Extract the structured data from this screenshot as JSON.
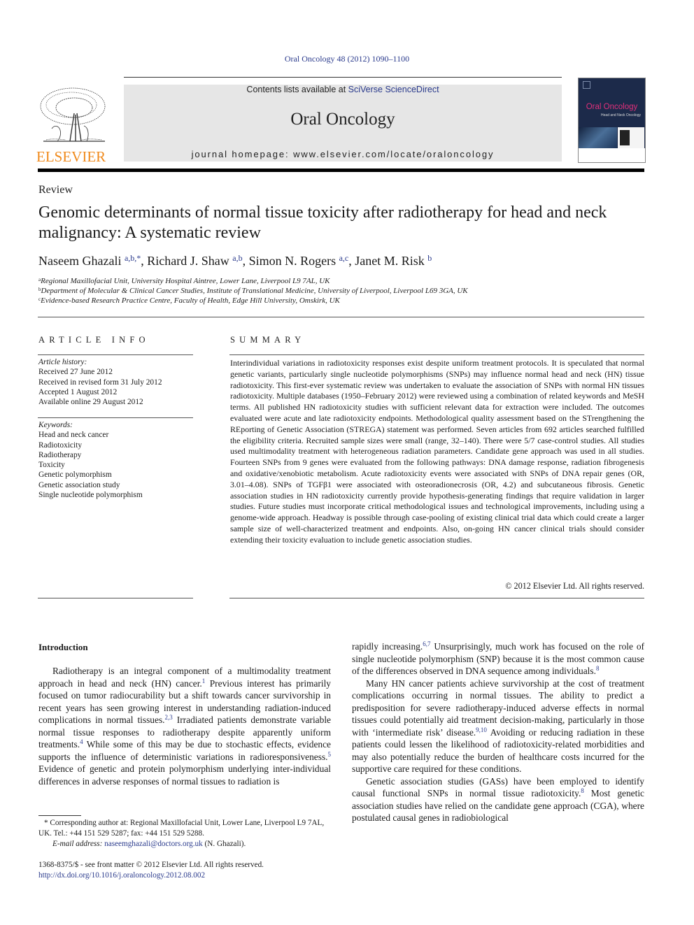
{
  "header": {
    "citation": "Oral Oncology 48 (2012) 1090–1100",
    "contents_prefix": "Contents lists available at ",
    "contents_link": "SciVerse ScienceDirect",
    "journal_title": "Oral Oncology",
    "homepage_label": "journal homepage: ",
    "homepage_url": "www.elsevier.com/locate/oraloncology",
    "publisher_logo_text": "ELSEVIER",
    "cover": {
      "title": "Oral Oncology",
      "subtitle": "Head and Neck Oncology"
    },
    "colors": {
      "link": "#2a3a8c",
      "elsevier_orange": "#f08a1c",
      "banner_bg": "#e6e6e6",
      "cover_bg": "#1c2a4a",
      "cover_title": "#e0307a"
    }
  },
  "article": {
    "section_type": "Review",
    "title": "Genomic determinants of normal tissue toxicity after radiotherapy for head and neck malignancy: A systematic review",
    "authors": [
      {
        "name": "Naseem Ghazali",
        "affil": "a,b,*"
      },
      {
        "name": "Richard J. Shaw",
        "affil": "a,b"
      },
      {
        "name": "Simon N. Rogers",
        "affil": "a,c"
      },
      {
        "name": "Janet M. Risk",
        "affil": "b"
      }
    ],
    "affiliations": [
      {
        "key": "a",
        "text": "Regional Maxillofacial Unit, University Hospital Aintree, Lower Lane, Liverpool L9 7AL, UK"
      },
      {
        "key": "b",
        "text": "Department of Molecular & Clinical Cancer Studies, Institute of Translational Medicine, University of Liverpool, Liverpool L69 3GA, UK"
      },
      {
        "key": "c",
        "text": "Evidence-based Research Practice Centre, Faculty of Health, Edge Hill University, Omskirk, UK"
      }
    ]
  },
  "article_info": {
    "heading": "ARTICLE INFO",
    "history_label": "Article history:",
    "history": [
      "Received 27 June 2012",
      "Received in revised form 31 July 2012",
      "Accepted 1 August 2012",
      "Available online 29 August 2012"
    ],
    "keywords_label": "Keywords:",
    "keywords": [
      "Head and neck cancer",
      "Radiotoxicity",
      "Radiotherapy",
      "Toxicity",
      "Genetic polymorphism",
      "Genetic association study",
      "Single nucleotide polymorphism"
    ]
  },
  "summary": {
    "heading": "SUMMARY",
    "text": "Interindividual variations in radiotoxicity responses exist despite uniform treatment protocols. It is speculated that normal genetic variants, particularly single nucleotide polymorphisms (SNPs) may influence normal head and neck (HN) tissue radiotoxicity. This first-ever systematic review was undertaken to evaluate the association of SNPs with normal HN tissues radiotoxicity. Multiple databases (1950–February 2012) were reviewed using a combination of related keywords and MeSH terms. All published HN radiotoxicity studies with sufficient relevant data for extraction were included. The outcomes evaluated were acute and late radiotoxicity endpoints. Methodological quality assessment based on the STrengthening the REporting of Genetic Association (STREGA) statement was performed. Seven articles from 692 articles searched fulfilled the eligibility criteria. Recruited sample sizes were small (range, 32–140). There were 5/7 case-control studies. All studies used multimodality treatment with heterogeneous radiation parameters. Candidate gene approach was used in all studies. Fourteen SNPs from 9 genes were evaluated from the following pathways: DNA damage response, radiation fibrogenesis and oxidative/xenobiotic metabolism. Acute radiotoxicity events were associated with SNPs of DNA repair genes (OR, 3.01–4.08). SNPs of TGFβ1 were associated with osteoradionecrosis (OR, 4.2) and subcutaneous fibrosis. Genetic association studies in HN radiotoxicity currently provide hypothesis-generating findings that require validation in larger studies. Future studies must incorporate critical methodological issues and technological improvements, including using a genome-wide approach. Headway is possible through case-pooling of existing clinical trial data which could create a larger sample size of well-characterized treatment and endpoints. Also, on-going HN cancer clinical trials should consider extending their toxicity evaluation to include genetic association studies.",
    "copyright": "© 2012 Elsevier Ltd. All rights reserved."
  },
  "body": {
    "intro_heading": "Introduction",
    "left_column": [
      {
        "segments": [
          {
            "t": "Radiotherapy is an integral component of a multimodality treatment approach in head and neck (HN) cancer."
          },
          {
            "ref": "1"
          },
          {
            "t": " Previous interest has primarily focused on tumor radiocurability but a shift towards cancer survivorship in recent years has seen growing interest in understanding radiation-induced complications in normal tissues."
          },
          {
            "ref": "2,3"
          },
          {
            "t": " Irradiated patients demonstrate variable normal tissue responses to radiotherapy despite apparently uniform treatments."
          },
          {
            "ref": "4"
          },
          {
            "t": " While some of this may be due to stochastic effects, evidence supports the influence of deterministic variations in radioresponsiveness."
          },
          {
            "ref": "5"
          },
          {
            "t": " Evidence of genetic and protein polymorphism underlying inter-individual differences in adverse responses of normal tissues to radiation is"
          }
        ]
      }
    ],
    "right_column": [
      {
        "noindent": true,
        "segments": [
          {
            "t": "rapidly increasing."
          },
          {
            "ref": "6,7"
          },
          {
            "t": " Unsurprisingly, much work has focused on the role of single nucleotide polymorphism (SNP) because it is the most common cause of the differences observed in DNA sequence among individuals."
          },
          {
            "ref": "8"
          }
        ]
      },
      {
        "segments": [
          {
            "t": "Many HN cancer patients achieve survivorship at the cost of treatment complications occurring in normal tissues. The ability to predict a predisposition for severe radiotherapy-induced adverse effects in normal tissues could potentially aid treatment decision-making, particularly in those with ‘intermediate risk’ disease."
          },
          {
            "ref": "9,10"
          },
          {
            "t": " Avoiding or reducing radiation in these patients could lessen the likelihood of radiotoxicity-related morbidities and may also potentially reduce the burden of healthcare costs incurred for the supportive care required for these conditions."
          }
        ]
      },
      {
        "segments": [
          {
            "t": "Genetic association studies (GASs) have been employed to identify causal functional SNPs in normal tissue radiotoxicity."
          },
          {
            "ref": "8"
          },
          {
            "t": " Most genetic association studies have relied on the candidate gene approach (CGA), where postulated causal genes in radiobiological"
          }
        ]
      }
    ]
  },
  "footnote": {
    "corresponding": "* Corresponding author at: Regional Maxillofacial Unit, Lower Lane, Liverpool L9 7AL, UK. Tel.: +44 151 529 5287; fax: +44 151 529 5288.",
    "email_label": "E-mail address:",
    "email": "naseemghazali@doctors.org.uk",
    "email_suffix": " (N. Ghazali).",
    "issn_line": "1368-8375/$ - see front matter © 2012 Elsevier Ltd. All rights reserved.",
    "doi": "http://dx.doi.org/10.1016/j.oraloncology.2012.08.002"
  }
}
